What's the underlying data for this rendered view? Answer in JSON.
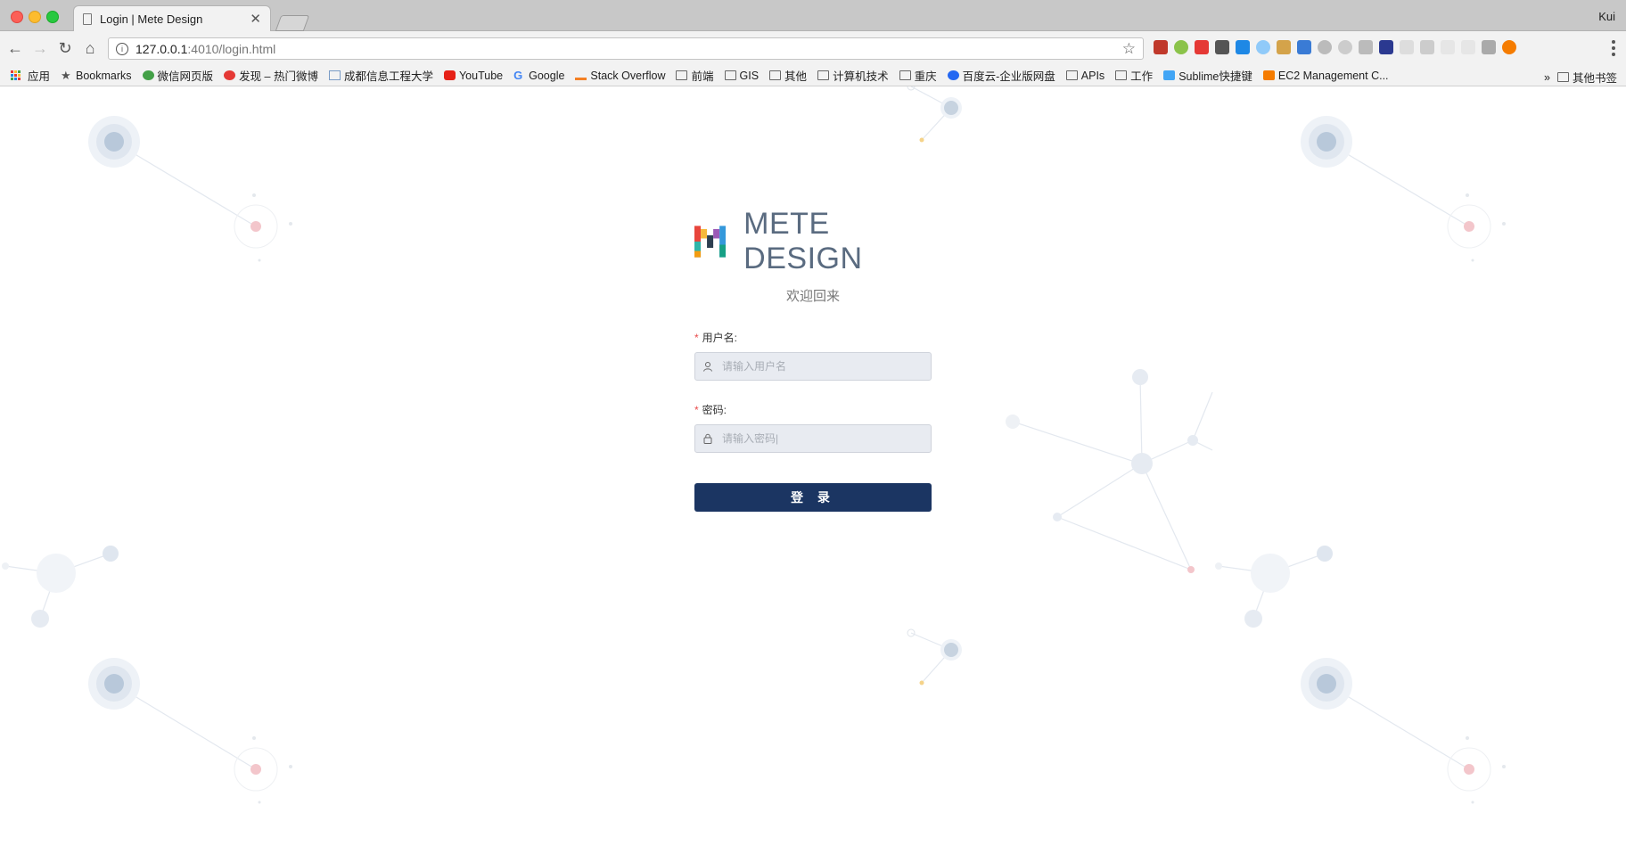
{
  "browser": {
    "tab_title": "Login | Mete Design",
    "user": "Kui",
    "url_host": "127.0.0.1",
    "url_path": ":4010/login.html",
    "info_glyph": "i",
    "star_glyph": "☆",
    "back_glyph": "←",
    "forward_glyph": "→",
    "reload_glyph": "↻",
    "home_glyph": "⌂",
    "close_glyph": "✕"
  },
  "bookmarks": {
    "items": [
      {
        "label": "应用",
        "icon": "apps-grid-icon"
      },
      {
        "label": "Bookmarks",
        "icon": "star-icon"
      },
      {
        "label": "微信网页版",
        "icon": "wechat-icon"
      },
      {
        "label": "发现 – 热门微博",
        "icon": "weibo-icon"
      },
      {
        "label": "成都信息工程大学",
        "icon": "page-icon"
      },
      {
        "label": "YouTube",
        "icon": "youtube-icon"
      },
      {
        "label": "Google",
        "icon": "google-icon"
      },
      {
        "label": "Stack Overflow",
        "icon": "stackoverflow-icon"
      },
      {
        "label": "前端",
        "icon": "folder-icon"
      },
      {
        "label": "GIS",
        "icon": "folder-icon"
      },
      {
        "label": "其他",
        "icon": "folder-icon"
      },
      {
        "label": "计算机技术",
        "icon": "folder-icon"
      },
      {
        "label": "重庆",
        "icon": "folder-icon"
      },
      {
        "label": "百度云-企业版网盘",
        "icon": "baidu-cloud-icon"
      },
      {
        "label": "APIs",
        "icon": "folder-icon"
      },
      {
        "label": "工作",
        "icon": "folder-icon"
      },
      {
        "label": "Sublime快捷键",
        "icon": "sublime-icon"
      },
      {
        "label": "EC2 Management C...",
        "icon": "aws-icon"
      }
    ],
    "overflow": "»",
    "other_folder": "其他书签"
  },
  "colors": {
    "primary_button": "#1b3562",
    "logo_text": "#5a6b80",
    "required_star": "#e94b4b",
    "input_bg": "#e8ebf1"
  },
  "login": {
    "brand": "METE DESIGN",
    "welcome": "欢迎回来",
    "username_label": "用户名:",
    "username_placeholder": "请输入用户名",
    "password_label": "密码:",
    "password_placeholder": "请输入密码|",
    "required_mark": "*",
    "submit_label": "登 录"
  }
}
